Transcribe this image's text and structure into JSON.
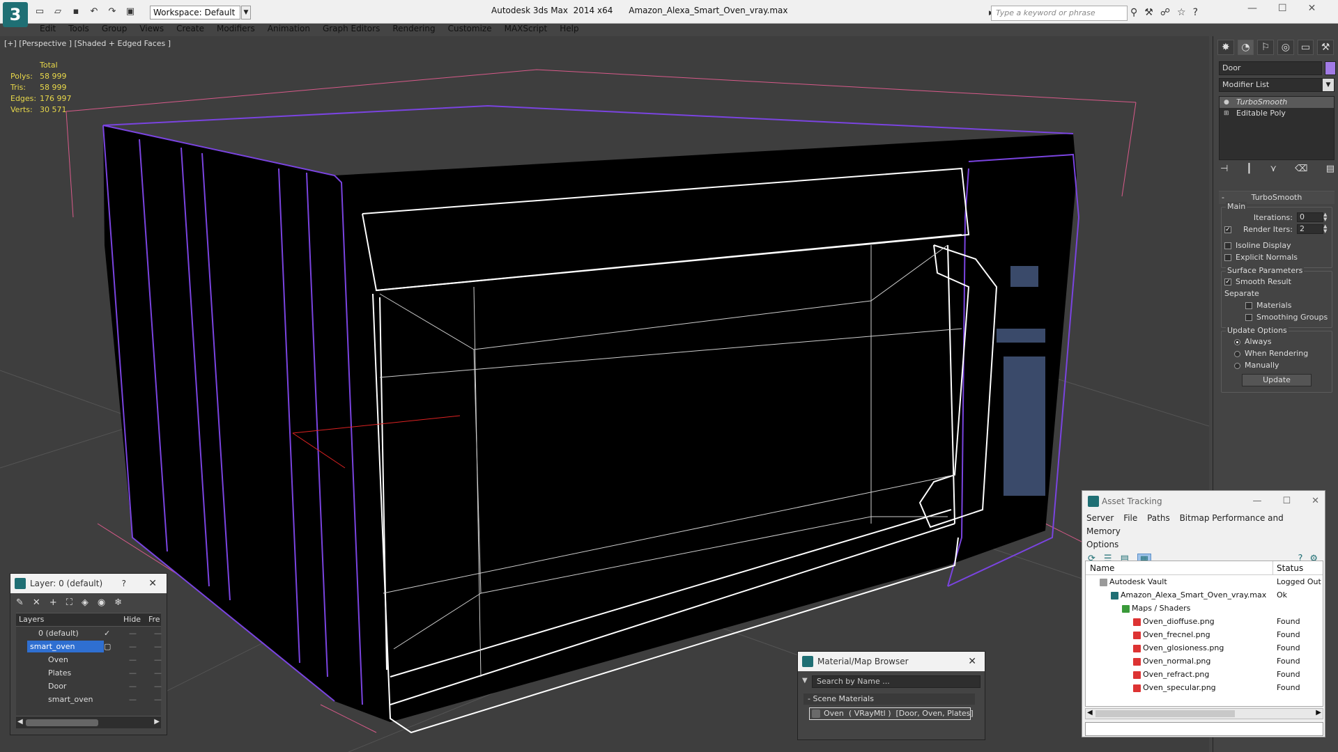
{
  "app": {
    "title": "Autodesk 3ds Max  2014 x64      Amazon_Alexa_Smart_Oven_vray.max",
    "workspace": "Workspace: Default",
    "keyword_placeholder": "Type a keyword or phrase"
  },
  "menu": [
    "Edit",
    "Tools",
    "Group",
    "Views",
    "Create",
    "Modifiers",
    "Animation",
    "Graph Editors",
    "Rendering",
    "Customize",
    "MAXScript",
    "Help"
  ],
  "viewport": {
    "label": "[+] [Perspective ] [Shaded + Edged Faces ]",
    "stats": {
      "header": "Total",
      "rows": [
        {
          "label": "Polys:",
          "value": "58 999"
        },
        {
          "label": "Tris:",
          "value": "58 999"
        },
        {
          "label": "Edges:",
          "value": "176 997"
        },
        {
          "label": "Verts:",
          "value": "30 571"
        }
      ]
    }
  },
  "command_panel": {
    "object_name": "Door",
    "object_color": "#a27be6",
    "modifier_list": "Modifier List",
    "stack": [
      "TurboSmooth",
      "Editable Poly"
    ],
    "rollout_title": "TurboSmooth",
    "main_label": "Main",
    "iterations_label": "Iterations:",
    "iterations_value": "0",
    "render_iters_label": "Render Iters:",
    "render_iters_value": "2",
    "isoline": "Isoline Display",
    "explicit_normals": "Explicit Normals",
    "surface_params": "Surface Parameters",
    "smooth_result": "Smooth Result",
    "separate": "Separate",
    "materials": "Materials",
    "smoothing_groups": "Smoothing Groups",
    "update_options": "Update Options",
    "always": "Always",
    "when_rendering": "When Rendering",
    "manually": "Manually",
    "update_button": "Update"
  },
  "layer_window": {
    "title": "Layer: 0 (default)",
    "help": "?",
    "col_layers": "Layers",
    "col_hide": "Hide",
    "col_freeze": "Fre",
    "rows": [
      {
        "name": "0 (default)",
        "selected": false
      },
      {
        "name": "smart_oven",
        "selected": true
      },
      {
        "name": "Oven",
        "selected": false
      },
      {
        "name": "Plates",
        "selected": false
      },
      {
        "name": "Door",
        "selected": false
      },
      {
        "name": "smart_oven",
        "selected": false
      }
    ]
  },
  "material_browser": {
    "title": "Material/Map Browser",
    "search_placeholder": "Search by Name ...",
    "section": "Scene Materials",
    "item": "Oven  ( VRayMtl )  [Door, Oven, Plates]"
  },
  "asset_tracking": {
    "title": "Asset Tracking",
    "menu": [
      "Server",
      "File",
      "Paths",
      "Bitmap Performance and Memory"
    ],
    "menu2": "Options",
    "col_name": "Name",
    "col_status": "Status",
    "rows": [
      {
        "name": "Autodesk Vault",
        "status": "Logged Out .",
        "indent": 0
      },
      {
        "name": "Amazon_Alexa_Smart_Oven_vray.max",
        "status": "Ok",
        "indent": 1
      },
      {
        "name": "Maps / Shaders",
        "status": "",
        "indent": 2
      },
      {
        "name": "Oven_dioffuse.png",
        "status": "Found",
        "indent": 3
      },
      {
        "name": "Oven_frecnel.png",
        "status": "Found",
        "indent": 3
      },
      {
        "name": "Oven_glosioness.png",
        "status": "Found",
        "indent": 3
      },
      {
        "name": "Oven_normal.png",
        "status": "Found",
        "indent": 3
      },
      {
        "name": "Oven_refract.png",
        "status": "Found",
        "indent": 3
      },
      {
        "name": "Oven_specular.png",
        "status": "Found",
        "indent": 3
      }
    ]
  }
}
